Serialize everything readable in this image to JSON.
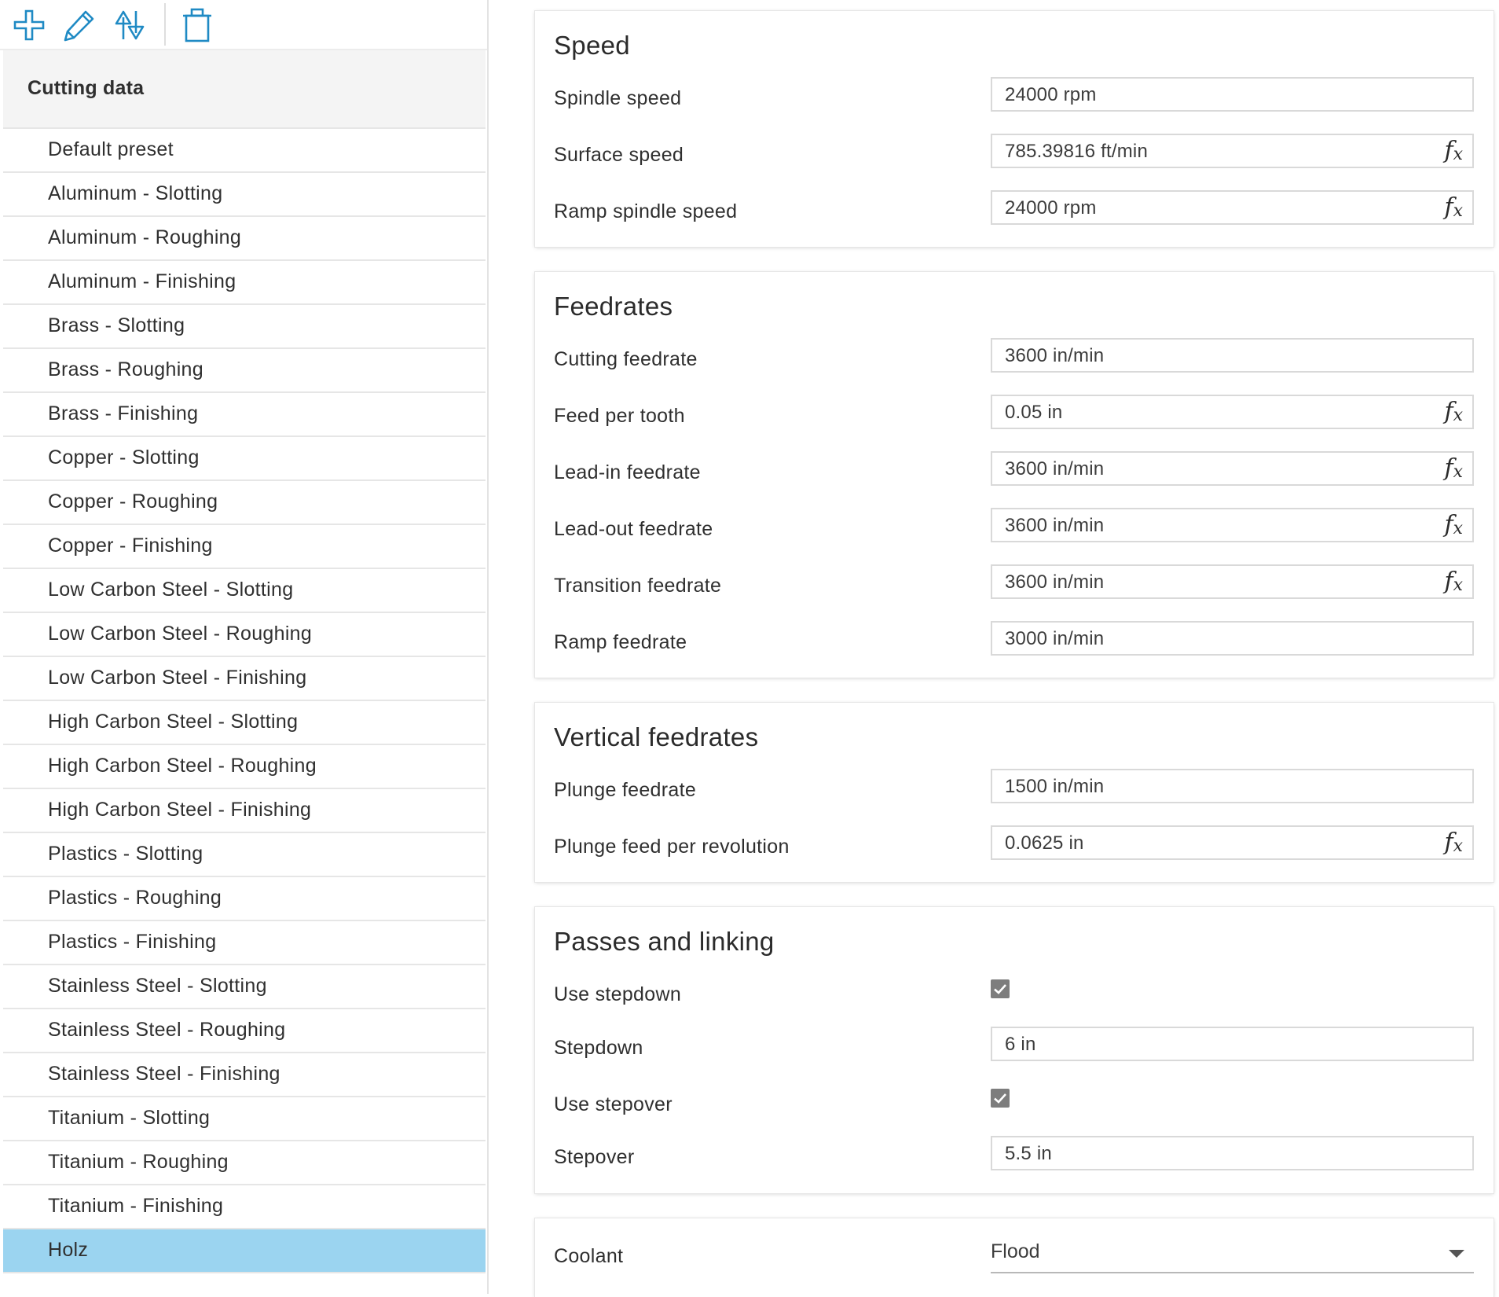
{
  "toolbar": {
    "icons": [
      "add-icon",
      "edit-icon",
      "sort-icon",
      "delete-icon"
    ],
    "accent_color": "#1f8ac4"
  },
  "list": {
    "header": "Cutting data",
    "items": [
      "Default preset",
      "Aluminum - Slotting",
      "Aluminum - Roughing",
      "Aluminum - Finishing",
      "Brass - Slotting",
      "Brass - Roughing",
      "Brass - Finishing",
      "Copper - Slotting",
      "Copper - Roughing",
      "Copper - Finishing",
      "Low Carbon Steel - Slotting",
      "Low Carbon Steel - Roughing",
      "Low Carbon Steel - Finishing",
      "High Carbon Steel - Slotting",
      "High Carbon Steel - Roughing",
      "High Carbon Steel - Finishing",
      "Plastics - Slotting",
      "Plastics - Roughing",
      "Plastics - Finishing",
      "Stainless Steel - Slotting",
      "Stainless Steel - Roughing",
      "Stainless Steel - Finishing",
      "Titanium - Slotting",
      "Titanium - Roughing",
      "Titanium - Finishing",
      "Holz"
    ],
    "selected": "Holz",
    "selected_color": "#9bd4f0"
  },
  "speed": {
    "title": "Speed",
    "spindle_speed": {
      "label": "Spindle speed",
      "value": "24000 rpm"
    },
    "surface_speed": {
      "label": "Surface speed",
      "value": "785.39816 ft/min"
    },
    "ramp_spindle_speed": {
      "label": "Ramp spindle speed",
      "value": "24000 rpm"
    }
  },
  "feedrates": {
    "title": "Feedrates",
    "cutting_feedrate": {
      "label": "Cutting feedrate",
      "value": "3600 in/min"
    },
    "feed_per_tooth": {
      "label": "Feed per tooth",
      "value": "0.05 in"
    },
    "lead_in_feedrate": {
      "label": "Lead-in feedrate",
      "value": "3600 in/min"
    },
    "lead_out_feedrate": {
      "label": "Lead-out feedrate",
      "value": "3600 in/min"
    },
    "transition_feedrate": {
      "label": "Transition feedrate",
      "value": "3600 in/min"
    },
    "ramp_feedrate": {
      "label": "Ramp feedrate",
      "value": "3000 in/min"
    }
  },
  "vertical_feedrates": {
    "title": "Vertical feedrates",
    "plunge_feedrate": {
      "label": "Plunge feedrate",
      "value": "1500 in/min"
    },
    "plunge_feed_per_revolution": {
      "label": "Plunge feed per revolution",
      "value": "0.0625 in"
    }
  },
  "passes": {
    "title": "Passes and linking",
    "use_stepdown": {
      "label": "Use stepdown",
      "checked": true
    },
    "stepdown": {
      "label": "Stepdown",
      "value": "6 in"
    },
    "use_stepover": {
      "label": "Use stepover",
      "checked": true
    },
    "stepover": {
      "label": "Stepover",
      "value": "5.5 in"
    }
  },
  "coolant": {
    "label": "Coolant",
    "value": "Flood"
  },
  "formula": {
    "f": "f",
    "x": "x"
  }
}
